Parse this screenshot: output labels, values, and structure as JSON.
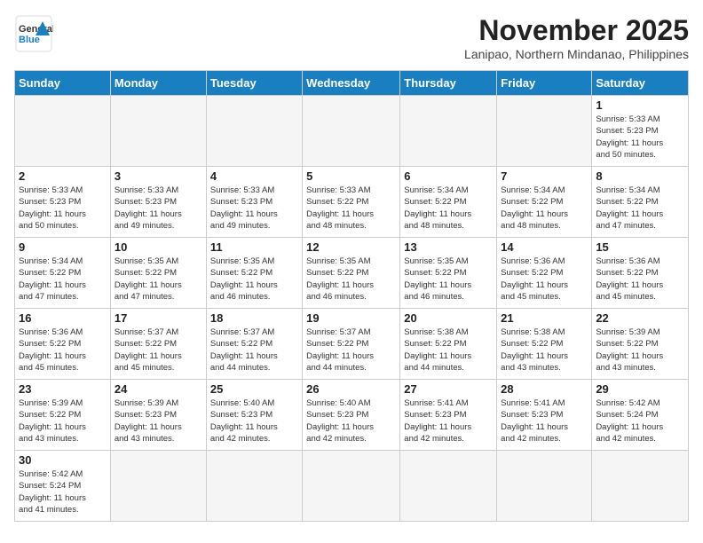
{
  "header": {
    "logo_general": "General",
    "logo_blue": "Blue",
    "month_title": "November 2025",
    "location": "Lanipao, Northern Mindanao, Philippines"
  },
  "weekdays": [
    "Sunday",
    "Monday",
    "Tuesday",
    "Wednesday",
    "Thursday",
    "Friday",
    "Saturday"
  ],
  "weeks": [
    [
      {
        "day": "",
        "info": ""
      },
      {
        "day": "",
        "info": ""
      },
      {
        "day": "",
        "info": ""
      },
      {
        "day": "",
        "info": ""
      },
      {
        "day": "",
        "info": ""
      },
      {
        "day": "",
        "info": ""
      },
      {
        "day": "1",
        "info": "Sunrise: 5:33 AM\nSunset: 5:23 PM\nDaylight: 11 hours\nand 50 minutes."
      }
    ],
    [
      {
        "day": "2",
        "info": "Sunrise: 5:33 AM\nSunset: 5:23 PM\nDaylight: 11 hours\nand 50 minutes."
      },
      {
        "day": "3",
        "info": "Sunrise: 5:33 AM\nSunset: 5:23 PM\nDaylight: 11 hours\nand 49 minutes."
      },
      {
        "day": "4",
        "info": "Sunrise: 5:33 AM\nSunset: 5:23 PM\nDaylight: 11 hours\nand 49 minutes."
      },
      {
        "day": "5",
        "info": "Sunrise: 5:33 AM\nSunset: 5:22 PM\nDaylight: 11 hours\nand 48 minutes."
      },
      {
        "day": "6",
        "info": "Sunrise: 5:34 AM\nSunset: 5:22 PM\nDaylight: 11 hours\nand 48 minutes."
      },
      {
        "day": "7",
        "info": "Sunrise: 5:34 AM\nSunset: 5:22 PM\nDaylight: 11 hours\nand 48 minutes."
      },
      {
        "day": "8",
        "info": "Sunrise: 5:34 AM\nSunset: 5:22 PM\nDaylight: 11 hours\nand 47 minutes."
      }
    ],
    [
      {
        "day": "9",
        "info": "Sunrise: 5:34 AM\nSunset: 5:22 PM\nDaylight: 11 hours\nand 47 minutes."
      },
      {
        "day": "10",
        "info": "Sunrise: 5:35 AM\nSunset: 5:22 PM\nDaylight: 11 hours\nand 47 minutes."
      },
      {
        "day": "11",
        "info": "Sunrise: 5:35 AM\nSunset: 5:22 PM\nDaylight: 11 hours\nand 46 minutes."
      },
      {
        "day": "12",
        "info": "Sunrise: 5:35 AM\nSunset: 5:22 PM\nDaylight: 11 hours\nand 46 minutes."
      },
      {
        "day": "13",
        "info": "Sunrise: 5:35 AM\nSunset: 5:22 PM\nDaylight: 11 hours\nand 46 minutes."
      },
      {
        "day": "14",
        "info": "Sunrise: 5:36 AM\nSunset: 5:22 PM\nDaylight: 11 hours\nand 45 minutes."
      },
      {
        "day": "15",
        "info": "Sunrise: 5:36 AM\nSunset: 5:22 PM\nDaylight: 11 hours\nand 45 minutes."
      }
    ],
    [
      {
        "day": "16",
        "info": "Sunrise: 5:36 AM\nSunset: 5:22 PM\nDaylight: 11 hours\nand 45 minutes."
      },
      {
        "day": "17",
        "info": "Sunrise: 5:37 AM\nSunset: 5:22 PM\nDaylight: 11 hours\nand 45 minutes."
      },
      {
        "day": "18",
        "info": "Sunrise: 5:37 AM\nSunset: 5:22 PM\nDaylight: 11 hours\nand 44 minutes."
      },
      {
        "day": "19",
        "info": "Sunrise: 5:37 AM\nSunset: 5:22 PM\nDaylight: 11 hours\nand 44 minutes."
      },
      {
        "day": "20",
        "info": "Sunrise: 5:38 AM\nSunset: 5:22 PM\nDaylight: 11 hours\nand 44 minutes."
      },
      {
        "day": "21",
        "info": "Sunrise: 5:38 AM\nSunset: 5:22 PM\nDaylight: 11 hours\nand 43 minutes."
      },
      {
        "day": "22",
        "info": "Sunrise: 5:39 AM\nSunset: 5:22 PM\nDaylight: 11 hours\nand 43 minutes."
      }
    ],
    [
      {
        "day": "23",
        "info": "Sunrise: 5:39 AM\nSunset: 5:22 PM\nDaylight: 11 hours\nand 43 minutes."
      },
      {
        "day": "24",
        "info": "Sunrise: 5:39 AM\nSunset: 5:23 PM\nDaylight: 11 hours\nand 43 minutes."
      },
      {
        "day": "25",
        "info": "Sunrise: 5:40 AM\nSunset: 5:23 PM\nDaylight: 11 hours\nand 42 minutes."
      },
      {
        "day": "26",
        "info": "Sunrise: 5:40 AM\nSunset: 5:23 PM\nDaylight: 11 hours\nand 42 minutes."
      },
      {
        "day": "27",
        "info": "Sunrise: 5:41 AM\nSunset: 5:23 PM\nDaylight: 11 hours\nand 42 minutes."
      },
      {
        "day": "28",
        "info": "Sunrise: 5:41 AM\nSunset: 5:23 PM\nDaylight: 11 hours\nand 42 minutes."
      },
      {
        "day": "29",
        "info": "Sunrise: 5:42 AM\nSunset: 5:24 PM\nDaylight: 11 hours\nand 42 minutes."
      }
    ],
    [
      {
        "day": "30",
        "info": "Sunrise: 5:42 AM\nSunset: 5:24 PM\nDaylight: 11 hours\nand 41 minutes."
      },
      {
        "day": "",
        "info": ""
      },
      {
        "day": "",
        "info": ""
      },
      {
        "day": "",
        "info": ""
      },
      {
        "day": "",
        "info": ""
      },
      {
        "day": "",
        "info": ""
      },
      {
        "day": "",
        "info": ""
      }
    ]
  ]
}
